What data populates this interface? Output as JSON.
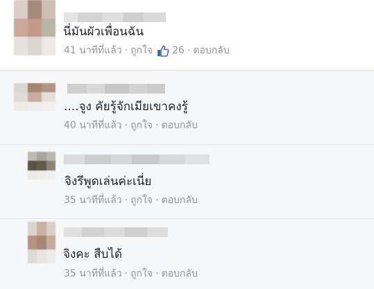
{
  "comments": [
    {
      "text": "นี่มันผัวเพื่อนฉัน",
      "time": "41 นาทีที่แล้ว",
      "like_label": "ถูกใจ",
      "like_count": "26",
      "reply_label": "ตอบกลับ",
      "separator": "·"
    },
    {
      "text": "....จูง คัยรู้จักเมียเขาคงรู้",
      "time": "40 นาทีที่แล้ว",
      "like_label": "ถูกใจ",
      "reply_label": "ตอบกลับ",
      "separator": "·"
    },
    {
      "text": "จิงรึพูดเล่นค่ะเนี่ย",
      "time": "35 นาทีที่แล้ว",
      "like_label": "ถูกใจ",
      "reply_label": "ตอบกลับ",
      "separator": "·"
    },
    {
      "text": "จิงคะ สืบได้",
      "time": "35 นาทีที่แล้ว",
      "like_label": "ถูกใจ",
      "reply_label": "ตอบกลับ",
      "separator": "·"
    }
  ],
  "colors": {
    "link_blue": "#4267b2",
    "meta_gray": "#90949c",
    "text_dark": "#1d2129"
  },
  "icons": {
    "like": "thumbs-up-icon"
  }
}
